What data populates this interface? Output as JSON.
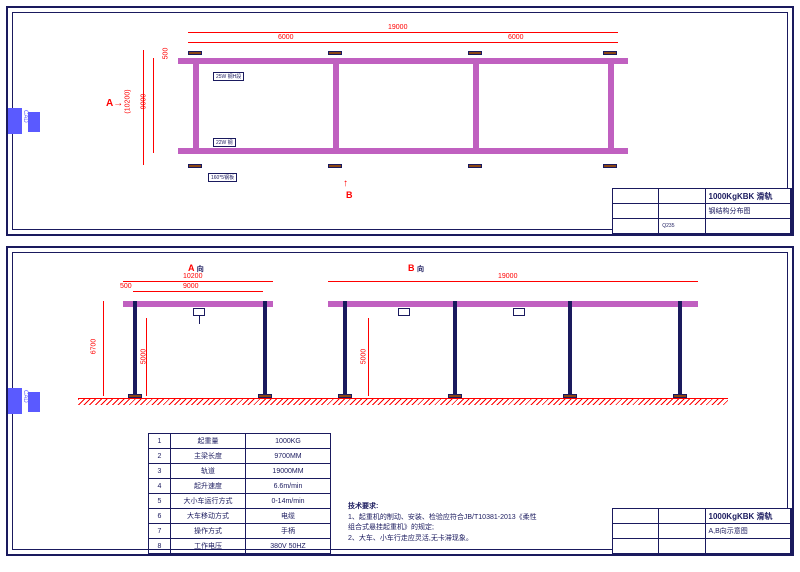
{
  "sheet1": {
    "title_main": "1000KgKBK 滑轨",
    "title_sub": "钢结构分布图",
    "material": "Q235",
    "dims": {
      "total_length": "19000",
      "span1": "6000",
      "span2": "6000",
      "width": "9000",
      "offset": "500",
      "width_ext": "(10200)",
      "small1": "22W 钢",
      "small2": "25W 钢H段",
      "small3": "160*5钢板",
      "view_a": "A",
      "view_b": "B"
    }
  },
  "sheet2": {
    "title_main": "1000KgKBK 滑轨",
    "title_sub": "A,B向示意图",
    "view_a": "A",
    "view_b": "B",
    "view_suffix": "向",
    "dims": {
      "a_total": "10200",
      "a_span": "9000",
      "a_offset": "500",
      "a_height": "6700",
      "a_clear": "5000",
      "b_total": "19000",
      "b_clear": "5000"
    },
    "specs": [
      {
        "n": "1",
        "label": "起重量",
        "val": "1000KG"
      },
      {
        "n": "2",
        "label": "主梁长度",
        "val": "9700MM"
      },
      {
        "n": "3",
        "label": "轨道",
        "val": "19000MM"
      },
      {
        "n": "4",
        "label": "起升速度",
        "val": "6.6m/min"
      },
      {
        "n": "5",
        "label": "大小车运行方式",
        "val": "0-14m/min"
      },
      {
        "n": "6",
        "label": "大车移动方式",
        "val": "电缆"
      },
      {
        "n": "7",
        "label": "操作方式",
        "val": "手柄"
      },
      {
        "n": "8",
        "label": "工作电压",
        "val": "380V  50HZ"
      }
    ],
    "notes_title": "技术要求:",
    "note1": "1、起重机的制动、安装、检验应符合JB/T10381-2013《柔性组合式悬挂起重机》的规定;",
    "note2": "2、大车、小车行走应灵活,无卡滞现象。"
  },
  "side_label": "CAD"
}
